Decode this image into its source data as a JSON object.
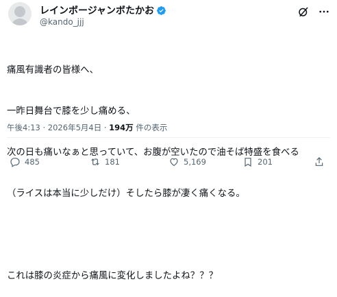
{
  "author": {
    "display_name": "レインボージャンボたかお",
    "handle": "@kando_jjj",
    "verified": true
  },
  "tweet": {
    "lines": [
      "痛風有識者の皆様へ、",
      "一昨日舞台で膝を少し痛める、",
      "次の日も痛いなぁと思っていて、お腹が空いたので油そば特盛を食べる",
      "（ライスは本当に少しだけ）そしたら膝が凄く痛くなる。",
      "",
      "これは膝の炎症から痛風に変化しましたよね？？？"
    ]
  },
  "meta": {
    "time": "午後4:13",
    "date": "2026年5月4日",
    "views": "194万",
    "views_suffix": "件の表示",
    "separator": "·"
  },
  "actions": {
    "replies": "485",
    "reposts": "181",
    "likes": "5,169",
    "bookmarks": "201"
  },
  "colors": {
    "verified_blue": "#1d9bf0",
    "secondary_text": "#536471",
    "primary_text": "#0f1419"
  },
  "icons": [
    "grok-icon",
    "more-icon",
    "reply-icon",
    "repost-icon",
    "like-icon",
    "bookmark-icon",
    "share-icon"
  ]
}
